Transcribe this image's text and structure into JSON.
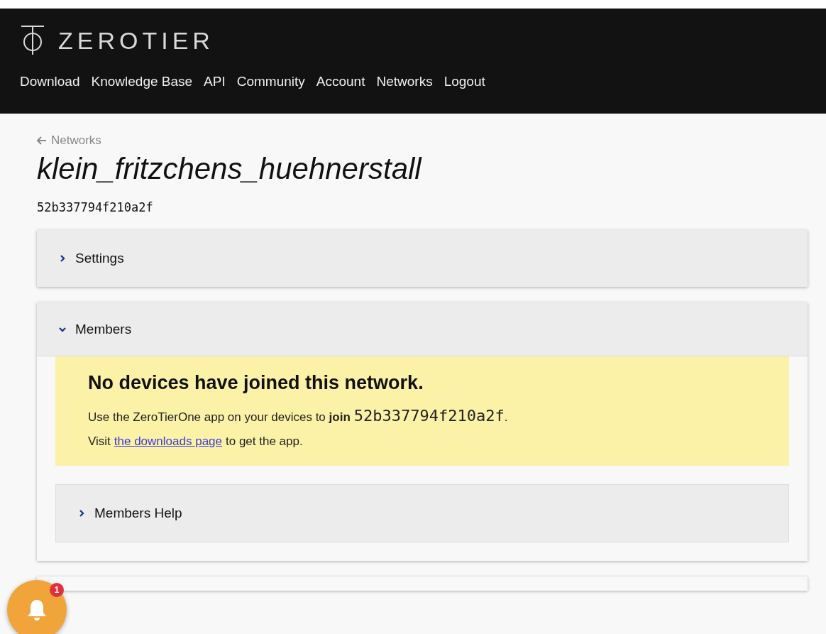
{
  "brand": {
    "name": "ZEROTIER"
  },
  "nav": [
    "Download",
    "Knowledge Base",
    "API",
    "Community",
    "Account",
    "Networks",
    "Logout"
  ],
  "back_link": "Networks",
  "network": {
    "name": "klein_fritzchens_huehnerstall",
    "id": "52b337794f210a2f"
  },
  "panels": [
    {
      "title": "Settings",
      "expanded": false
    },
    {
      "title": "Members",
      "expanded": true,
      "notice": {
        "heading": "No devices have joined this network.",
        "line_1": "Use the ZeroTierOne app on your devices to **join**",
        "network_id": "52b337794f210a2f",
        "line_1_end": ".",
        "line_2_start": "Visit",
        "link": "the downloads page",
        "line_2_end": "to get the app."
      },
      "sub_panel": {
        "title": "Members Help",
        "expanded": false
      }
    }
  ],
  "notification": {
    "count": "1"
  }
}
